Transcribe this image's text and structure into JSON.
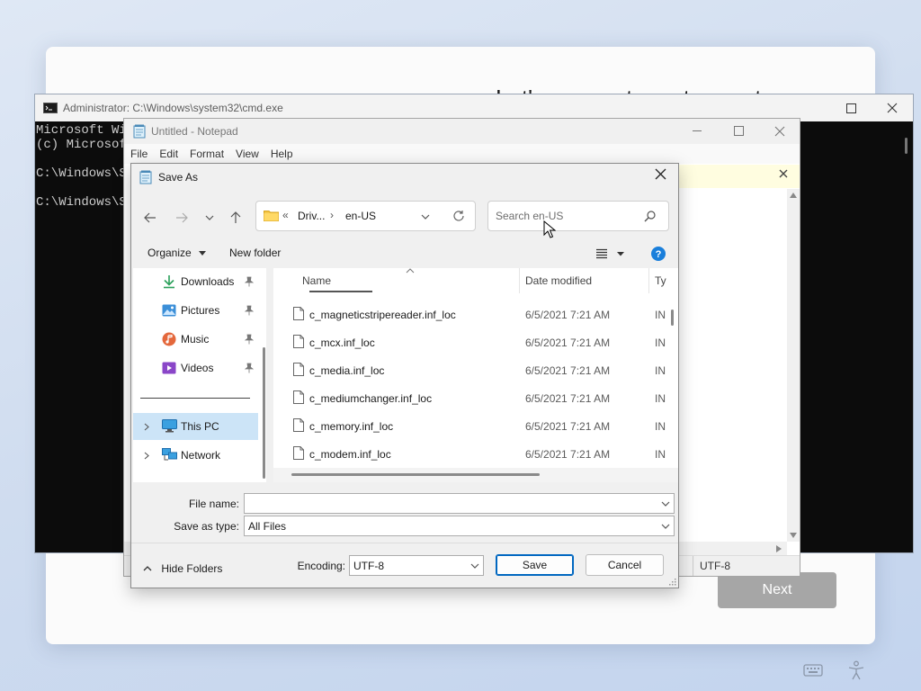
{
  "oobe": {
    "heading": "Let's connect you to a network",
    "next_label": "Next",
    "keyboard_icon": "keyboard-icon",
    "accessibility_icon": "accessibility-icon"
  },
  "cmd": {
    "title": "Administrator: C:\\Windows\\system32\\cmd.exe",
    "lines": [
      "Microsoft Wi",
      "(c) Microsof",
      "",
      "C:\\Windows\\Sy",
      "",
      "C:\\Windows\\Sy"
    ]
  },
  "notepad": {
    "title": "Untitled - Notepad",
    "menu": [
      "File",
      "Edit",
      "Format",
      "View",
      "Help"
    ],
    "status_encoding": "UTF-8"
  },
  "save_as": {
    "title": "Save As",
    "breadcrumb": {
      "prefix": "«",
      "segments": [
        "Driv...",
        "en-US"
      ]
    },
    "search_placeholder": "Search en-US",
    "toolbar": {
      "organize": "Organize",
      "new_folder": "New folder"
    },
    "nav": {
      "quick": [
        {
          "label": "Downloads",
          "icon": "download-icon"
        },
        {
          "label": "Pictures",
          "icon": "pictures-icon"
        },
        {
          "label": "Music",
          "icon": "music-icon"
        },
        {
          "label": "Videos",
          "icon": "videos-icon"
        }
      ],
      "this_pc": "This PC",
      "network": "Network"
    },
    "columns": {
      "name": "Name",
      "date": "Date modified",
      "type": "Ty"
    },
    "files": [
      {
        "name": "c_magneticstripereader.inf_loc",
        "date": "6/5/2021 7:21 AM",
        "type": "IN"
      },
      {
        "name": "c_mcx.inf_loc",
        "date": "6/5/2021 7:21 AM",
        "type": "IN"
      },
      {
        "name": "c_media.inf_loc",
        "date": "6/5/2021 7:21 AM",
        "type": "IN"
      },
      {
        "name": "c_mediumchanger.inf_loc",
        "date": "6/5/2021 7:21 AM",
        "type": "IN"
      },
      {
        "name": "c_memory.inf_loc",
        "date": "6/5/2021 7:21 AM",
        "type": "IN"
      },
      {
        "name": "c_modem.inf_loc",
        "date": "6/5/2021 7:21 AM",
        "type": "IN"
      }
    ],
    "file_name_label": "File name:",
    "file_name_value": "",
    "save_as_type_label": "Save as type:",
    "save_as_type_value": "All Files",
    "hide_folders": "Hide Folders",
    "encoding_label": "Encoding:",
    "encoding_value": "UTF-8",
    "save": "Save",
    "cancel": "Cancel"
  },
  "colors": {
    "accent": "#0067c0",
    "selection": "#cce4f7",
    "console_bg": "#0c0c0c",
    "next_disabled": "#a6a6a6"
  }
}
